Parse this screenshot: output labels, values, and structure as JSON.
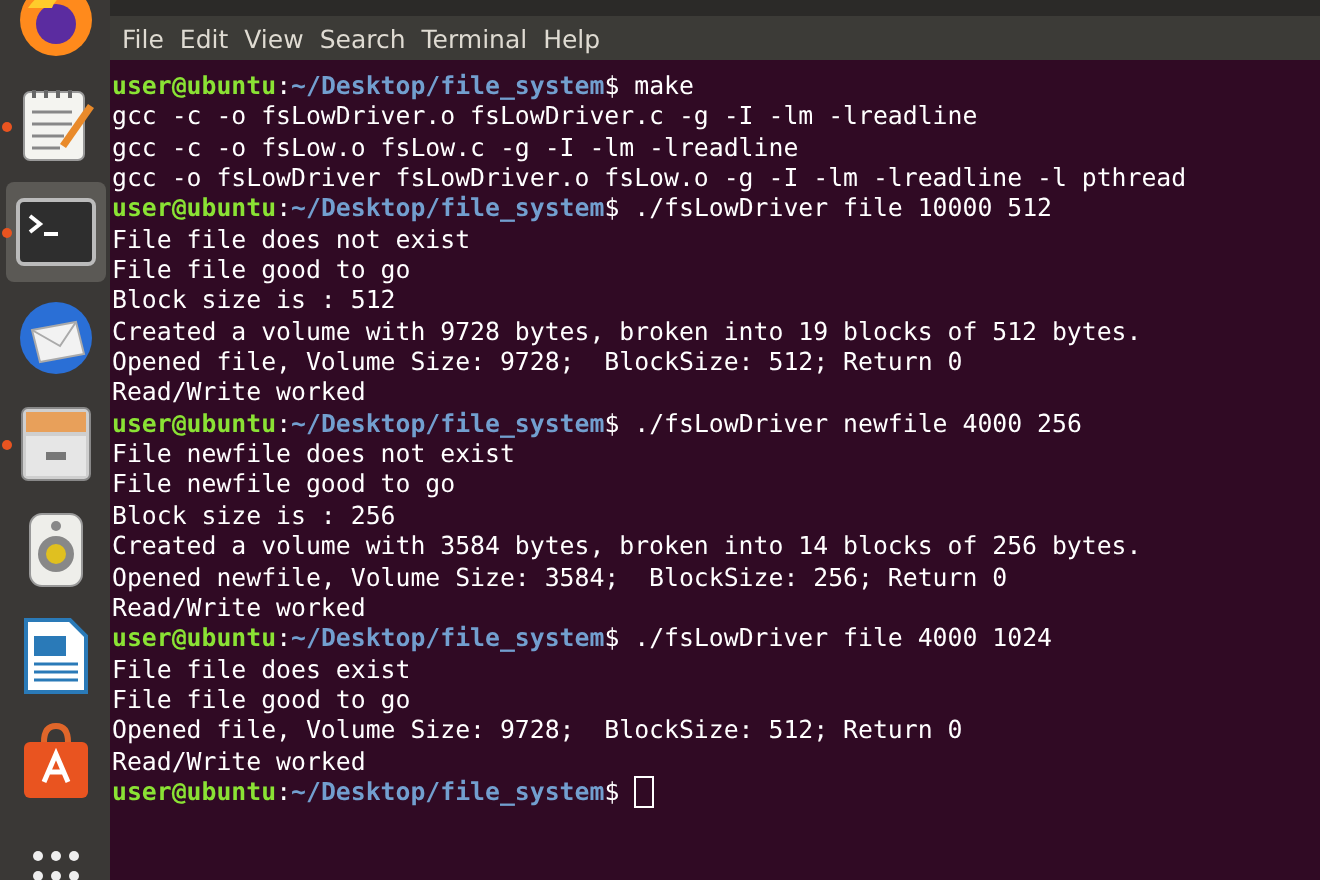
{
  "dock": {
    "items": [
      {
        "kind": "browser",
        "running": false,
        "selected": false
      },
      {
        "kind": "editor",
        "running": true,
        "selected": false
      },
      {
        "kind": "terminal",
        "running": true,
        "selected": true
      },
      {
        "kind": "mail",
        "running": false,
        "selected": false
      },
      {
        "kind": "files",
        "running": true,
        "selected": false
      },
      {
        "kind": "speaker",
        "running": false,
        "selected": false
      },
      {
        "kind": "writer",
        "running": false,
        "selected": false
      },
      {
        "kind": "software",
        "running": false,
        "selected": false
      },
      {
        "kind": "apps",
        "running": false,
        "selected": false
      }
    ]
  },
  "menu_bar": [
    "File",
    "Edit",
    "View",
    "Search",
    "Terminal",
    "Help"
  ],
  "terminal": {
    "lines": [
      {
        "kind": "prompt",
        "user": "user@ubuntu",
        "separator": ":",
        "path": "~/Desktop/file_system",
        "symbol": "$",
        "command": "make",
        "cursor": false
      },
      {
        "kind": "output",
        "text": "gcc -c -o fsLowDriver.o fsLowDriver.c -g -I -lm -lreadline"
      },
      {
        "kind": "output",
        "text": "gcc -c -o fsLow.o fsLow.c -g -I -lm -lreadline"
      },
      {
        "kind": "output",
        "text": "gcc -o fsLowDriver fsLowDriver.o fsLow.o -g -I -lm -lreadline -l pthread"
      },
      {
        "kind": "prompt",
        "user": "user@ubuntu",
        "separator": ":",
        "path": "~/Desktop/file_system",
        "symbol": "$",
        "command": "./fsLowDriver file 10000 512",
        "cursor": false
      },
      {
        "kind": "output",
        "text": "File file does not exist"
      },
      {
        "kind": "output",
        "text": "File file good to go"
      },
      {
        "kind": "output",
        "text": "Block size is : 512"
      },
      {
        "kind": "output",
        "text": "Created a volume with 9728 bytes, broken into 19 blocks of 512 bytes."
      },
      {
        "kind": "output",
        "text": "Opened file, Volume Size: 9728;  BlockSize: 512; Return 0"
      },
      {
        "kind": "output",
        "text": "Read/Write worked"
      },
      {
        "kind": "prompt",
        "user": "user@ubuntu",
        "separator": ":",
        "path": "~/Desktop/file_system",
        "symbol": "$",
        "command": "./fsLowDriver newfile 4000 256",
        "cursor": false
      },
      {
        "kind": "output",
        "text": "File newfile does not exist"
      },
      {
        "kind": "output",
        "text": "File newfile good to go"
      },
      {
        "kind": "output",
        "text": "Block size is : 256"
      },
      {
        "kind": "output",
        "text": "Created a volume with 3584 bytes, broken into 14 blocks of 256 bytes."
      },
      {
        "kind": "output",
        "text": "Opened newfile, Volume Size: 3584;  BlockSize: 256; Return 0"
      },
      {
        "kind": "output",
        "text": "Read/Write worked"
      },
      {
        "kind": "prompt",
        "user": "user@ubuntu",
        "separator": ":",
        "path": "~/Desktop/file_system",
        "symbol": "$",
        "command": "./fsLowDriver file 4000 1024",
        "cursor": false
      },
      {
        "kind": "output",
        "text": "File file does exist"
      },
      {
        "kind": "output",
        "text": "File file good to go"
      },
      {
        "kind": "output",
        "text": "Opened file, Volume Size: 9728;  BlockSize: 512; Return 0"
      },
      {
        "kind": "output",
        "text": "Read/Write worked"
      },
      {
        "kind": "prompt",
        "user": "user@ubuntu",
        "separator": ":",
        "path": "~/Desktop/file_system",
        "symbol": "$",
        "cursor": true
      }
    ]
  }
}
